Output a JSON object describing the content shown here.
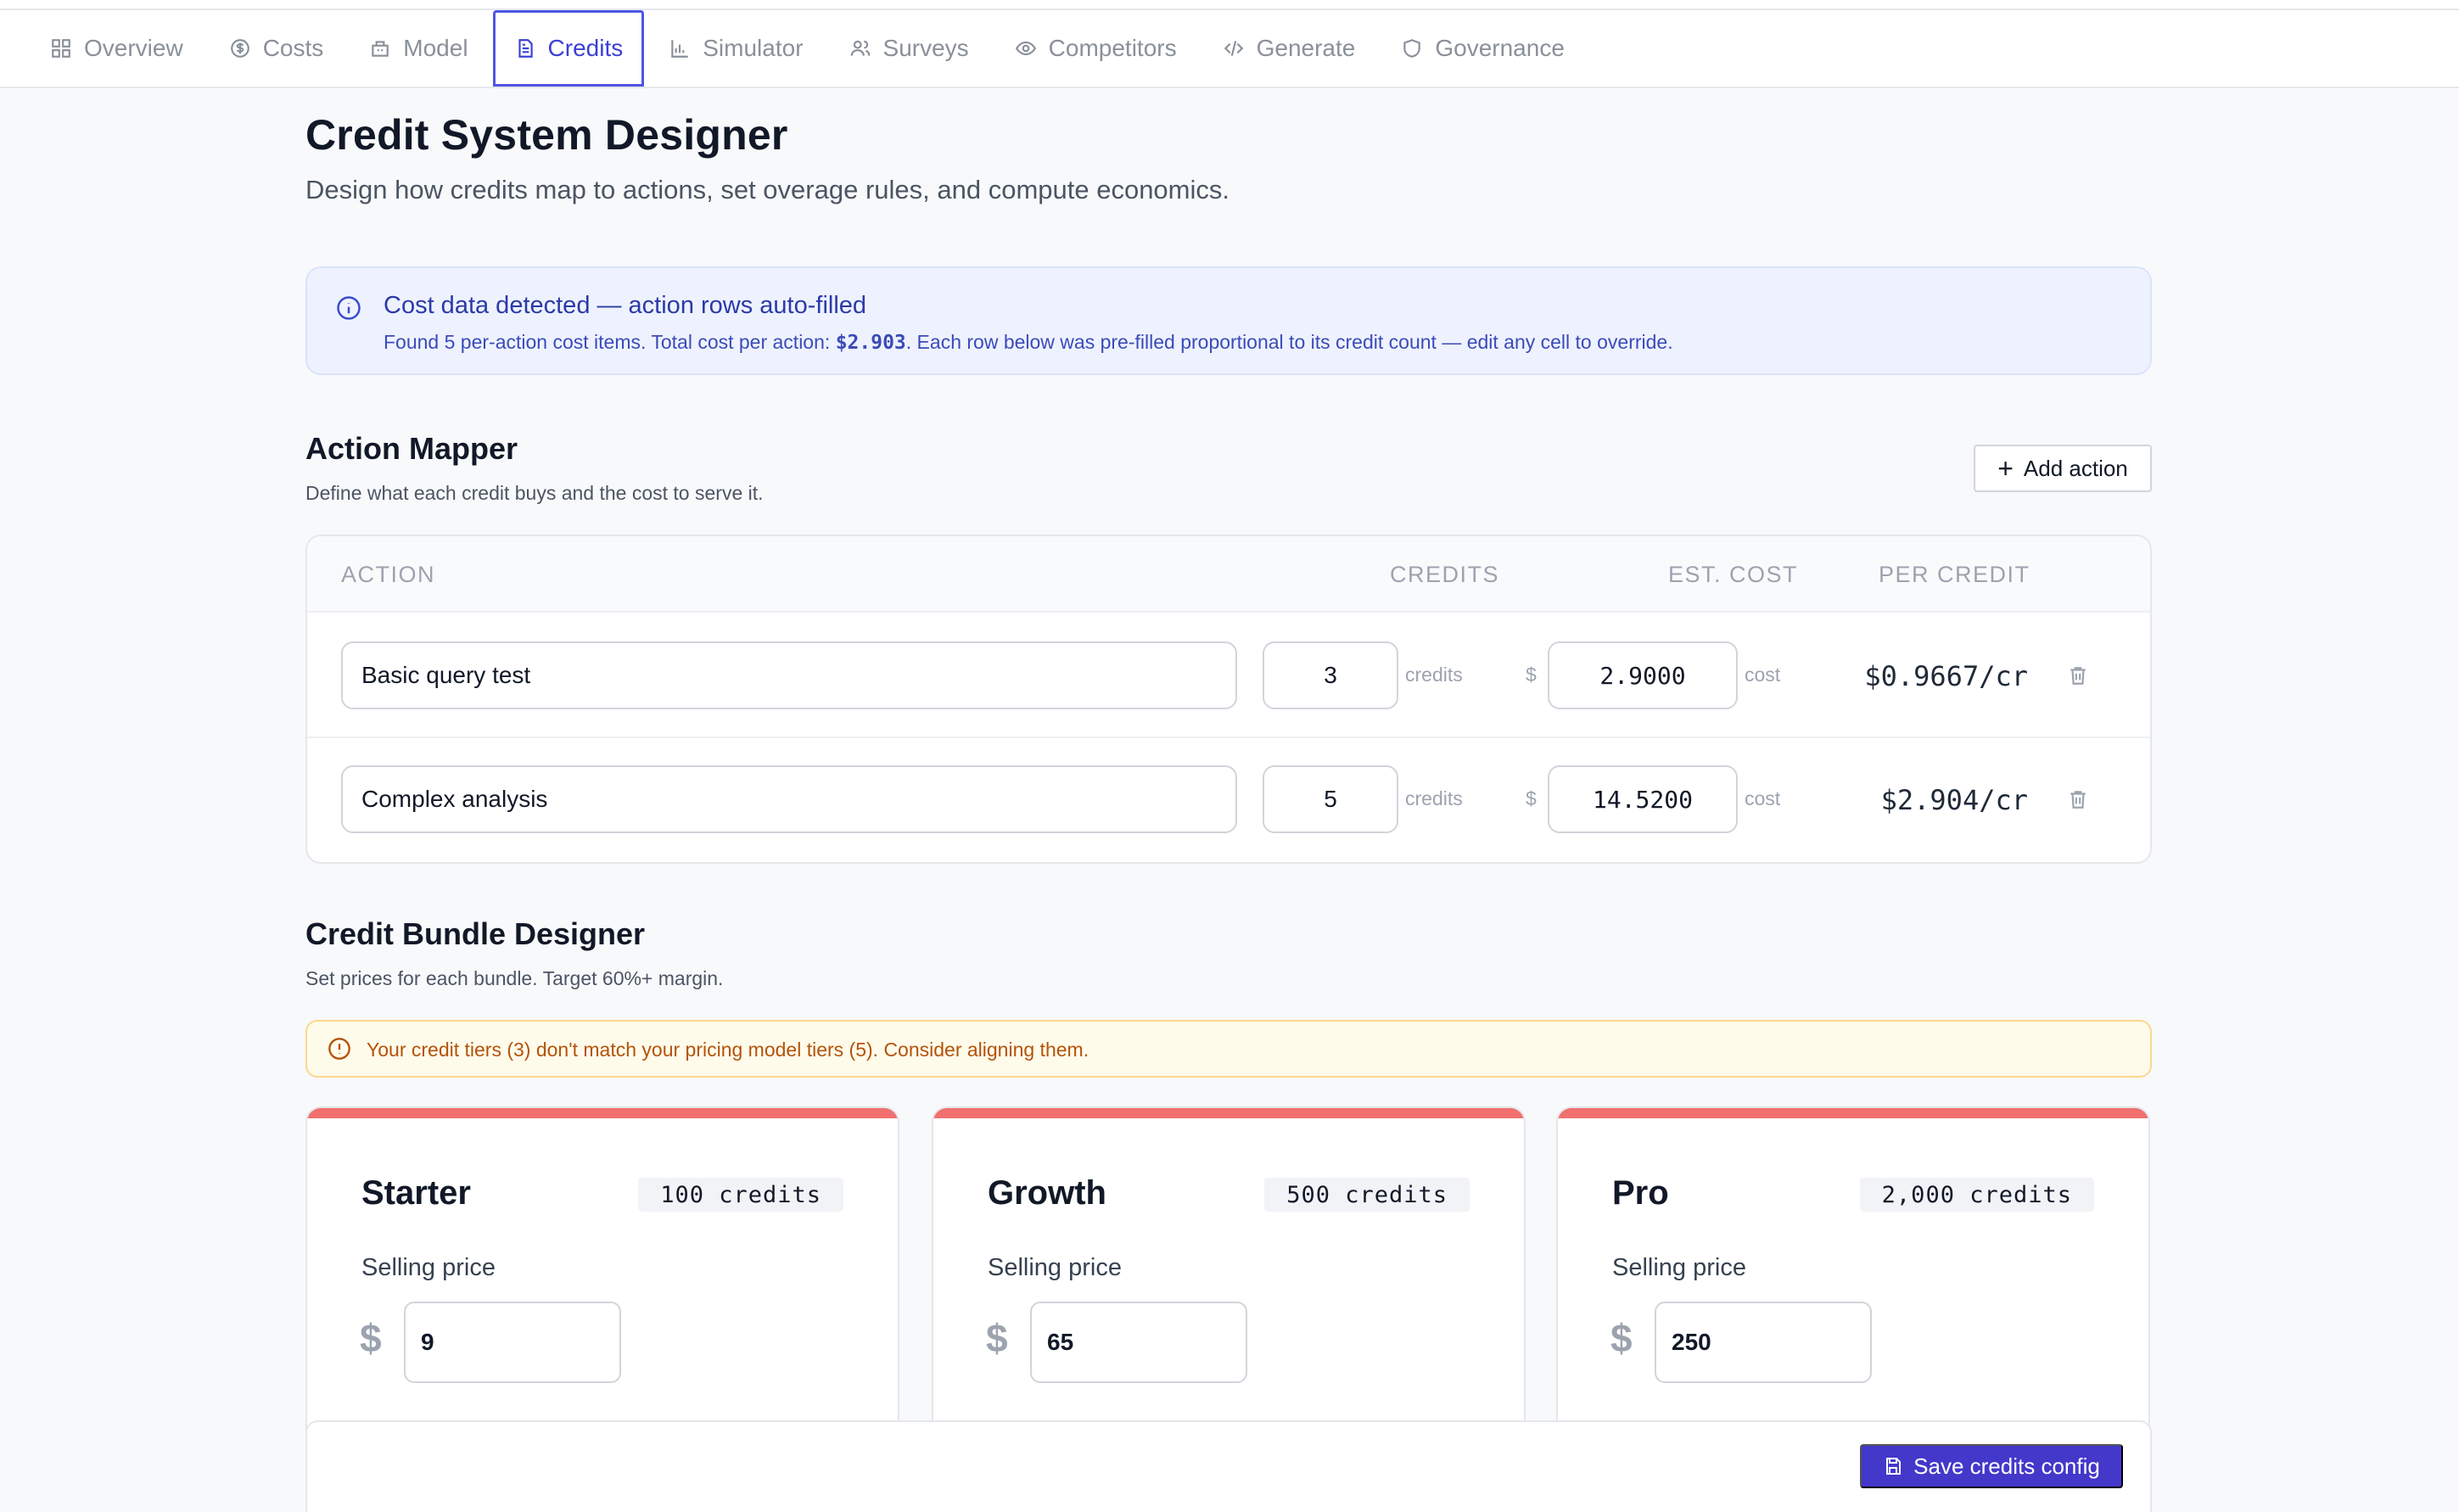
{
  "tabs": [
    {
      "label": "Overview",
      "icon": "grid-icon"
    },
    {
      "label": "Costs",
      "icon": "dollar-circle-icon"
    },
    {
      "label": "Model",
      "icon": "building-icon"
    },
    {
      "label": "Credits",
      "icon": "document-icon",
      "active": true
    },
    {
      "label": "Simulator",
      "icon": "bar-chart-icon"
    },
    {
      "label": "Surveys",
      "icon": "users-icon"
    },
    {
      "label": "Competitors",
      "icon": "eye-icon"
    },
    {
      "label": "Generate",
      "icon": "code-icon"
    },
    {
      "label": "Governance",
      "icon": "shield-icon"
    }
  ],
  "header": {
    "title": "Credit System Designer",
    "subtitle": "Design how credits map to actions, set overage rules, and compute economics."
  },
  "info": {
    "title": "Cost data detected — action rows auto-filled",
    "text_before": "Found 5 per-action cost items. Total cost per action: ",
    "total": "$2.903",
    "text_after": ". Each row below was pre-filled proportional to its credit count — edit any cell to override."
  },
  "action_mapper": {
    "title": "Action Mapper",
    "subtitle": "Define what each credit buys and the cost to serve it.",
    "add_label": "Add action",
    "columns": {
      "action": "ACTION",
      "credits": "CREDITS",
      "est_cost": "EST. COST",
      "per_credit": "PER CREDIT"
    },
    "credits_unit": "credits",
    "currency": "$",
    "cost_unit": "cost",
    "rows": [
      {
        "name": "Basic query test",
        "credits": "3",
        "cost": "2.9000",
        "per_credit": "$0.9667/cr"
      },
      {
        "name": "Complex analysis",
        "credits": "5",
        "cost": "14.5200",
        "per_credit": "$2.904/cr"
      }
    ]
  },
  "bundle_designer": {
    "title": "Credit Bundle Designer",
    "subtitle": "Set prices for each bundle. Target 60%+ margin.",
    "warning": "Your credit tiers (3) don't match your pricing model tiers (5). Consider aligning them.",
    "price_label": "Selling price",
    "currency": "$",
    "bundles": [
      {
        "name": "Starter",
        "credits": "100 credits",
        "price": "9"
      },
      {
        "name": "Growth",
        "credits": "500 credits",
        "price": "65"
      },
      {
        "name": "Pro",
        "credits": "2,000 credits",
        "price": "250"
      }
    ]
  },
  "footer": {
    "save_label": "Save credits config"
  },
  "colors": {
    "accent": "#4338ca",
    "bundle_bar": "#f07070",
    "warning": "#b45309",
    "info": "#2b3aa8"
  }
}
